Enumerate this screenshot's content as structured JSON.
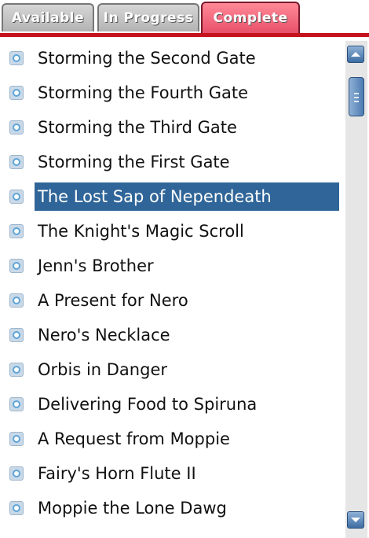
{
  "tabs": [
    {
      "label": "Available",
      "active": false
    },
    {
      "label": "In Progress",
      "active": false
    },
    {
      "label": "Complete",
      "active": true
    }
  ],
  "quests": [
    {
      "label": "Storming the Second Gate",
      "selected": false
    },
    {
      "label": "Storming the Fourth Gate",
      "selected": false
    },
    {
      "label": "Storming the Third Gate",
      "selected": false
    },
    {
      "label": "Storming the First Gate",
      "selected": false
    },
    {
      "label": "The Lost Sap of Nependeath",
      "selected": true
    },
    {
      "label": "The Knight's Magic Scroll",
      "selected": false
    },
    {
      "label": "Jenn's Brother",
      "selected": false
    },
    {
      "label": "A Present for Nero",
      "selected": false
    },
    {
      "label": "Nero's Necklace",
      "selected": false
    },
    {
      "label": "Orbis in Danger",
      "selected": false
    },
    {
      "label": "Delivering Food to Spiruna",
      "selected": false
    },
    {
      "label": "A Request from Moppie",
      "selected": false
    },
    {
      "label": "Fairy's Horn Flute II",
      "selected": false
    },
    {
      "label": "Moppie the Lone Dawg",
      "selected": false
    }
  ],
  "icons": {
    "bullet": "quest-complete-icon",
    "scroll_up": "arrow-up-icon",
    "scroll_down": "arrow-down-icon"
  },
  "colors": {
    "active_tab": "#e8506a",
    "inactive_tab": "#b3b3b3",
    "divider": "#c5121d",
    "selection": "#2f6598"
  }
}
